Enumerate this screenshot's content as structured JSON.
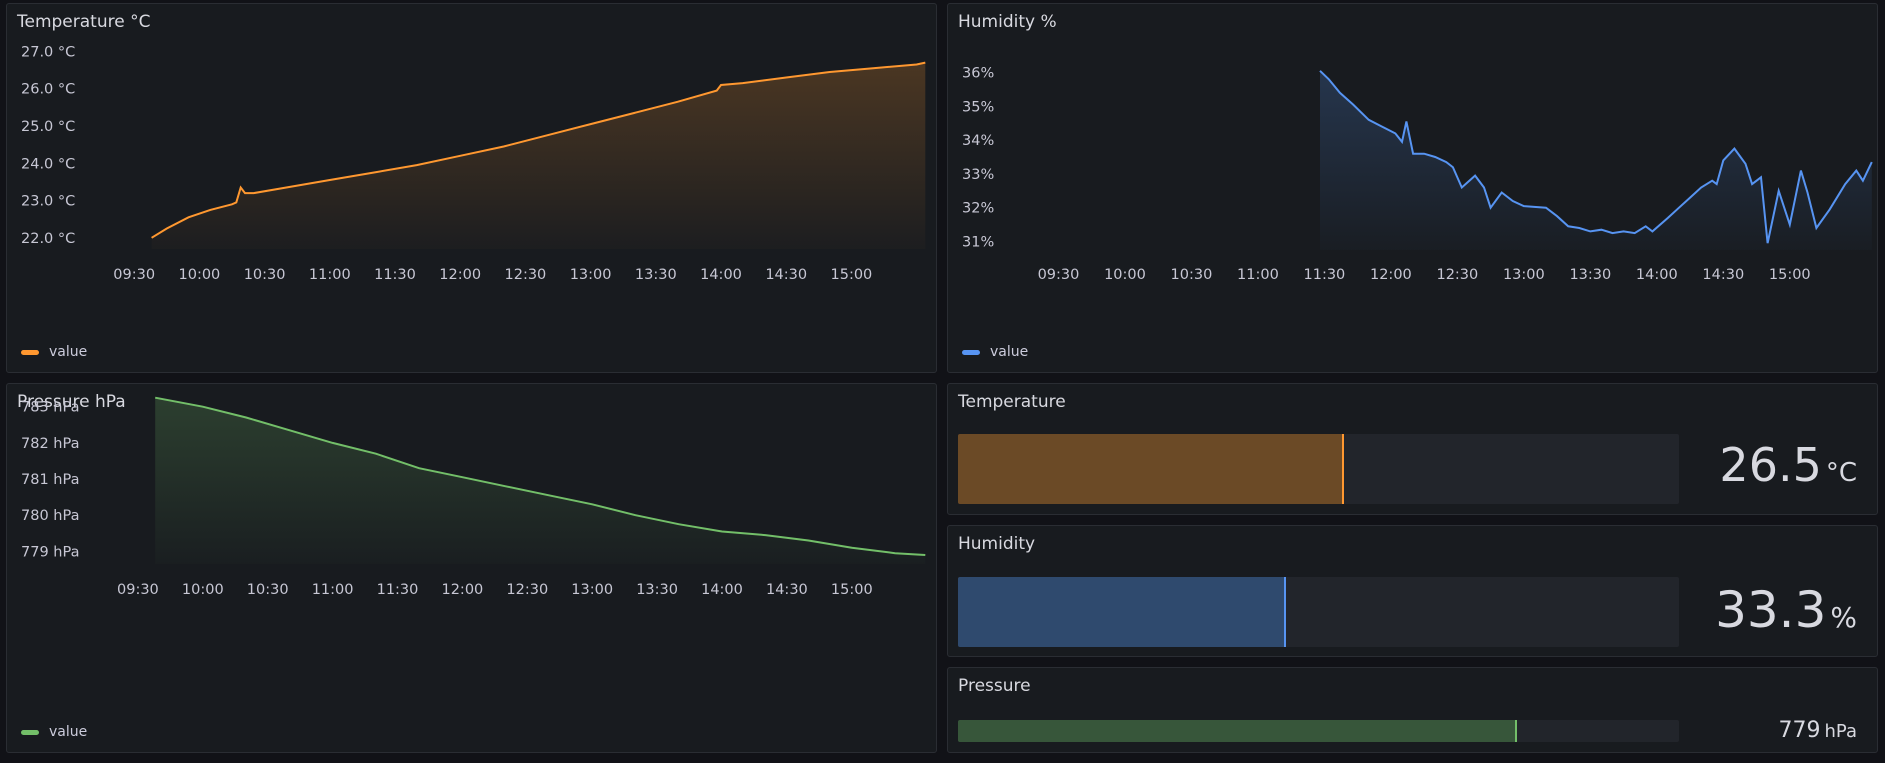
{
  "panels": {
    "temperature_chart": {
      "title": "Temperature °C",
      "legend": "value",
      "color": "#ff9830"
    },
    "humidity_chart": {
      "title": "Humidity %",
      "legend": "value",
      "color": "#5794f2"
    },
    "pressure_chart": {
      "title": "Pressure hPa",
      "legend": "value",
      "color": "#73bf69"
    },
    "temperature_gauge": {
      "title": "Temperature",
      "value": "26.5",
      "unit": "°C",
      "fill_fraction": 0.532,
      "fill_color": "#6b4a26",
      "edge_color": "#ff9830"
    },
    "humidity_gauge": {
      "title": "Humidity",
      "value": "33.3",
      "unit": "%",
      "fill_fraction": 0.452,
      "fill_color": "#2f4a6e",
      "edge_color": "#5794f2"
    },
    "pressure_gauge": {
      "title": "Pressure",
      "value": "779",
      "unit": "hPa",
      "fill_fraction": 0.773,
      "fill_color": "#37563a",
      "edge_color": "#73bf69"
    }
  },
  "chart_data": [
    {
      "type": "area",
      "x_ticks": [
        "09:30",
        "10:00",
        "10:30",
        "11:00",
        "11:30",
        "12:00",
        "12:30",
        "13:00",
        "13:30",
        "14:00",
        "14:30",
        "15:00"
      ],
      "y_ticks": [
        "27.0 °C",
        "26.0 °C",
        "25.0 °C",
        "24.0 °C",
        "23.0 °C",
        "22.0 °C"
      ],
      "ylim": [
        21.7,
        27.2
      ],
      "xlim_minutes": [
        540,
        938
      ],
      "series": [
        {
          "name": "value",
          "x": [
            578,
            585,
            595,
            605,
            615,
            617,
            619,
            621,
            625,
            640,
            660,
            680,
            700,
            720,
            740,
            760,
            780,
            800,
            820,
            838,
            840,
            850,
            870,
            890,
            910,
            930,
            934
          ],
          "values": [
            22.0,
            22.25,
            22.55,
            22.75,
            22.9,
            22.95,
            23.35,
            23.2,
            23.2,
            23.35,
            23.55,
            23.75,
            23.95,
            24.2,
            24.45,
            24.75,
            25.05,
            25.35,
            25.65,
            25.95,
            26.1,
            26.15,
            26.3,
            26.45,
            26.55,
            26.65,
            26.7
          ]
        }
      ]
    },
    {
      "type": "area",
      "x_ticks": [
        "09:30",
        "10:00",
        "10:30",
        "11:00",
        "11:30",
        "12:00",
        "12:30",
        "13:00",
        "13:30",
        "14:00",
        "14:30",
        "15:00"
      ],
      "y_ticks": [
        "36%",
        "35%",
        "34%",
        "33%",
        "32%",
        "31%"
      ],
      "ylim": [
        30.75,
        36.4
      ],
      "xlim_minutes": [
        540,
        938
      ],
      "series": [
        {
          "name": "value",
          "x": [
            688,
            692,
            697,
            703,
            710,
            716,
            722,
            725,
            727,
            730,
            735,
            740,
            745,
            748,
            752,
            758,
            762,
            765,
            770,
            775,
            780,
            790,
            795,
            800,
            805,
            810,
            815,
            820,
            825,
            830,
            835,
            838,
            845,
            850,
            855,
            860,
            865,
            867,
            870,
            875,
            880,
            883,
            887,
            890,
            895,
            900,
            905,
            908,
            912,
            918,
            925,
            930,
            933,
            937
          ],
          "values": [
            36.05,
            35.8,
            35.4,
            35.05,
            34.6,
            34.4,
            34.2,
            33.95,
            34.55,
            33.6,
            33.6,
            33.5,
            33.35,
            33.2,
            32.6,
            32.95,
            32.6,
            32.0,
            32.45,
            32.2,
            32.05,
            32.0,
            31.75,
            31.45,
            31.4,
            31.3,
            31.35,
            31.25,
            31.3,
            31.25,
            31.45,
            31.3,
            31.7,
            32.0,
            32.3,
            32.6,
            32.8,
            32.7,
            33.4,
            33.75,
            33.3,
            32.7,
            32.9,
            30.95,
            32.5,
            31.5,
            33.1,
            32.45,
            31.4,
            31.95,
            32.7,
            33.1,
            32.8,
            33.35
          ]
        }
      ]
    },
    {
      "type": "area",
      "x_ticks": [
        "09:30",
        "10:00",
        "10:30",
        "11:00",
        "11:30",
        "12:00",
        "12:30",
        "13:00",
        "13:30",
        "14:00",
        "14:30",
        "15:00"
      ],
      "y_ticks": [
        "783 hPa",
        "782 hPa",
        "781 hPa",
        "780 hPa",
        "779 hPa"
      ],
      "ylim": [
        778.65,
        783.6
      ],
      "xlim_minutes": [
        540,
        938
      ],
      "series": [
        {
          "name": "value",
          "x": [
            578,
            600,
            620,
            640,
            660,
            680,
            700,
            720,
            740,
            760,
            780,
            800,
            820,
            840,
            860,
            880,
            900,
            920,
            934
          ],
          "values": [
            783.25,
            783.0,
            782.7,
            782.35,
            782.0,
            781.7,
            781.3,
            781.05,
            780.8,
            780.55,
            780.3,
            780.0,
            779.75,
            779.55,
            779.45,
            779.3,
            779.1,
            778.95,
            778.9
          ]
        }
      ]
    }
  ]
}
